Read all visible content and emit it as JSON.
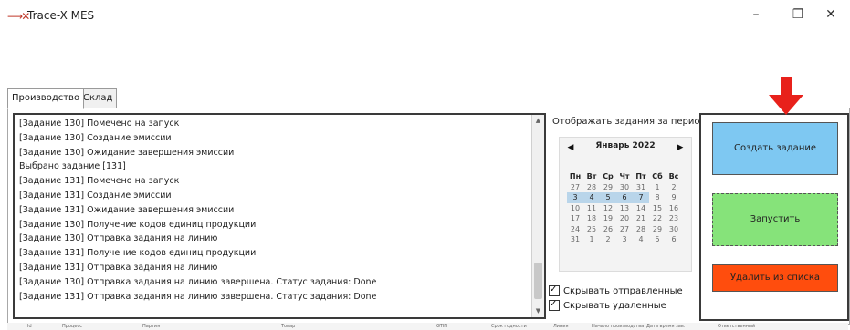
{
  "window": {
    "title": "Trace-X MES",
    "minimize": "–",
    "restore": "❐",
    "close": "✕"
  },
  "tabs": [
    {
      "label": "Производство",
      "active": true
    },
    {
      "label": "Склад",
      "active": false
    }
  ],
  "log_lines": [
    "[Задание 130] Помечено на запуск",
    "[Задание 130] Создание эмиссии",
    "[Задание 130] Ожидание завершения эмиссии",
    "Выбрано задание [131]",
    "[Задание 131] Помечено на запуск",
    "[Задание 131] Создание эмиссии",
    "[Задание 131] Ожидание завершения эмиссии",
    "[Задание 130] Получение кодов единиц продукции",
    "[Задание 130] Отправка задания на линию",
    "[Задание 131] Получение кодов единиц продукции",
    "[Задание 131] Отправка задания на линию",
    "[Задание 130] Отправка задания на линию завершена. Статус задания: Done",
    "[Задание 131] Отправка задания на линию завершена. Статус задания: Done"
  ],
  "period": {
    "label": "Отображать задания за период:"
  },
  "calendar": {
    "prev": "◀",
    "next": "▶",
    "month": "Январь 2022",
    "weekdays": [
      "Пн",
      "Вт",
      "Ср",
      "Чт",
      "Пт",
      "Сб",
      "Вс"
    ],
    "weeks": [
      [
        {
          "d": "27"
        },
        {
          "d": "28"
        },
        {
          "d": "29"
        },
        {
          "d": "30"
        },
        {
          "d": "31"
        },
        {
          "d": "1"
        },
        {
          "d": "2"
        }
      ],
      [
        {
          "d": "3",
          "sel": true
        },
        {
          "d": "4",
          "sel": true
        },
        {
          "d": "5",
          "sel": true
        },
        {
          "d": "6",
          "sel": true
        },
        {
          "d": "7",
          "sel": true
        },
        {
          "d": "8"
        },
        {
          "d": "9"
        }
      ],
      [
        {
          "d": "10"
        },
        {
          "d": "11"
        },
        {
          "d": "12"
        },
        {
          "d": "13"
        },
        {
          "d": "14"
        },
        {
          "d": "15"
        },
        {
          "d": "16"
        }
      ],
      [
        {
          "d": "17"
        },
        {
          "d": "18"
        },
        {
          "d": "19"
        },
        {
          "d": "20"
        },
        {
          "d": "21"
        },
        {
          "d": "22"
        },
        {
          "d": "23"
        }
      ],
      [
        {
          "d": "24"
        },
        {
          "d": "25"
        },
        {
          "d": "26"
        },
        {
          "d": "27"
        },
        {
          "d": "28"
        },
        {
          "d": "29"
        },
        {
          "d": "30"
        }
      ],
      [
        {
          "d": "31"
        },
        {
          "d": "1"
        },
        {
          "d": "2"
        },
        {
          "d": "3"
        },
        {
          "d": "4"
        },
        {
          "d": "5"
        },
        {
          "d": "6"
        }
      ]
    ]
  },
  "checkboxes": {
    "hide_sent": {
      "label": "Скрывать отправленные",
      "checked": true
    },
    "hide_deleted": {
      "label": "Скрывать удаленные",
      "checked": true
    }
  },
  "buttons": {
    "create": "Создать задание",
    "run": "Запустить",
    "remove": "Удалить из списка"
  },
  "colors": {
    "create": "#7ec8f2",
    "run": "#86e37a",
    "remove": "#ff4d0d",
    "arrow": "#e8211b"
  },
  "grid_columns": [
    "Id",
    "Процесс",
    "Партия",
    "Товар",
    "GTIN",
    "Срок годности",
    "Линия",
    "Начало производства",
    "Дата время зав.",
    "Ответственный"
  ]
}
